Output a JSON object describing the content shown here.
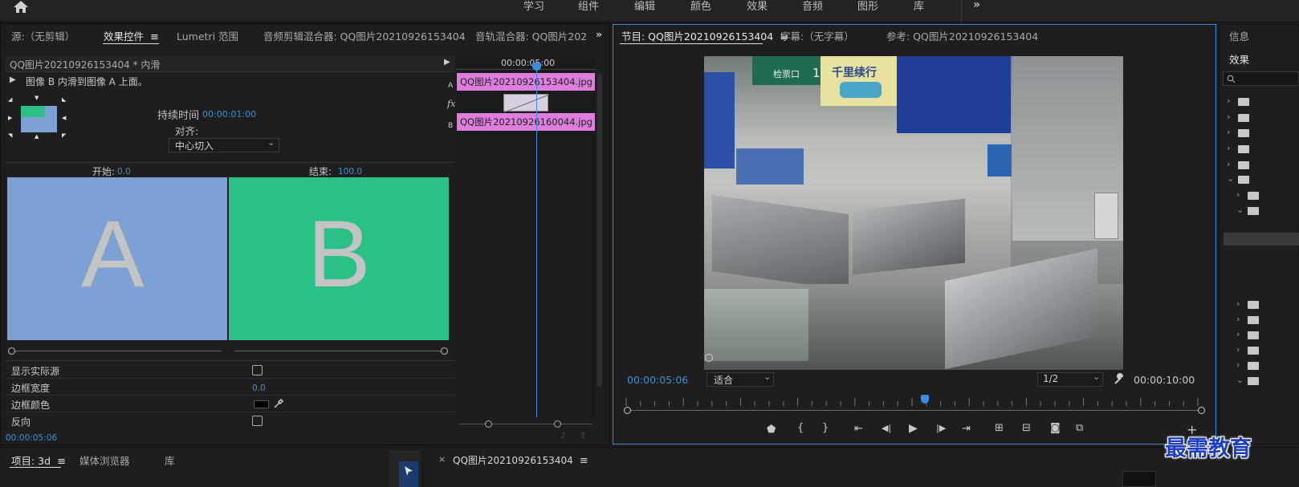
{
  "workspaces": [
    "学习",
    "组件",
    "编辑",
    "颜色",
    "效果",
    "音频",
    "图形",
    "库"
  ],
  "left_tabs": {
    "source": "源:（无剪辑）",
    "effect_controls": "效果控件",
    "lumetri": "Lumetri 范围",
    "audio_clip_mixer": "音频剪辑混合器: QQ图片20210926153404",
    "audio_track_mixer": "音轨混合器: QQ图片202"
  },
  "effect_controls": {
    "clip_header": "QQ图片20210926153404 * 内滑",
    "description": "图像 B 内滑到图像 A 上面。",
    "duration_label": "持续时间",
    "duration_value": "00:00:01:00",
    "align_label": "对齐:",
    "align_value": "中心切入",
    "start_label": "开始:",
    "start_value": "0.0",
    "end_label": "结束:",
    "end_value": "100.0",
    "preview_a": "A",
    "preview_b": "B",
    "show_actual_sources": "显示实际源",
    "border_width_label": "边框宽度",
    "border_width_value": "0.0",
    "border_color_label": "边框颜色",
    "reverse_label": "反向",
    "timecode": "00:00:05:06",
    "colors": {
      "a_panel": "#7ea1d4",
      "b_panel": "#2bc185",
      "label_grey": "#c4c4c4",
      "clip": "#dd7ddd",
      "accent_blue": "#3a91d9"
    }
  },
  "mini_timeline": {
    "timecode": "00:00:05:00",
    "clip_a": "QQ图片20210926153404.jpg",
    "clip_b": "QQ图片20210926160044.jpg",
    "track_a": "A",
    "track_b": "B",
    "fx": "fx"
  },
  "program": {
    "tab": "节目: QQ图片20210926153404",
    "captions_tab": "字幕:（无字幕）",
    "reference_tab": "参考: QQ图片20210926153404",
    "timecode": "00:00:05:06",
    "fit": "适合",
    "resolution": "1/2",
    "duration": "00:00:10:00",
    "signs": {
      "check_in": "检票口",
      "gate_num": "1",
      "ad_title": "千里续行"
    }
  },
  "right_panel": {
    "info_tab": "信息",
    "effects_tab": "效果"
  },
  "bottom": {
    "project_tab": "项目: 3d",
    "media_browser": "媒体浏览器",
    "library": "库",
    "sequence_tab": "QQ图片20210926153404",
    "close": "×"
  },
  "watermark": "最需教育"
}
